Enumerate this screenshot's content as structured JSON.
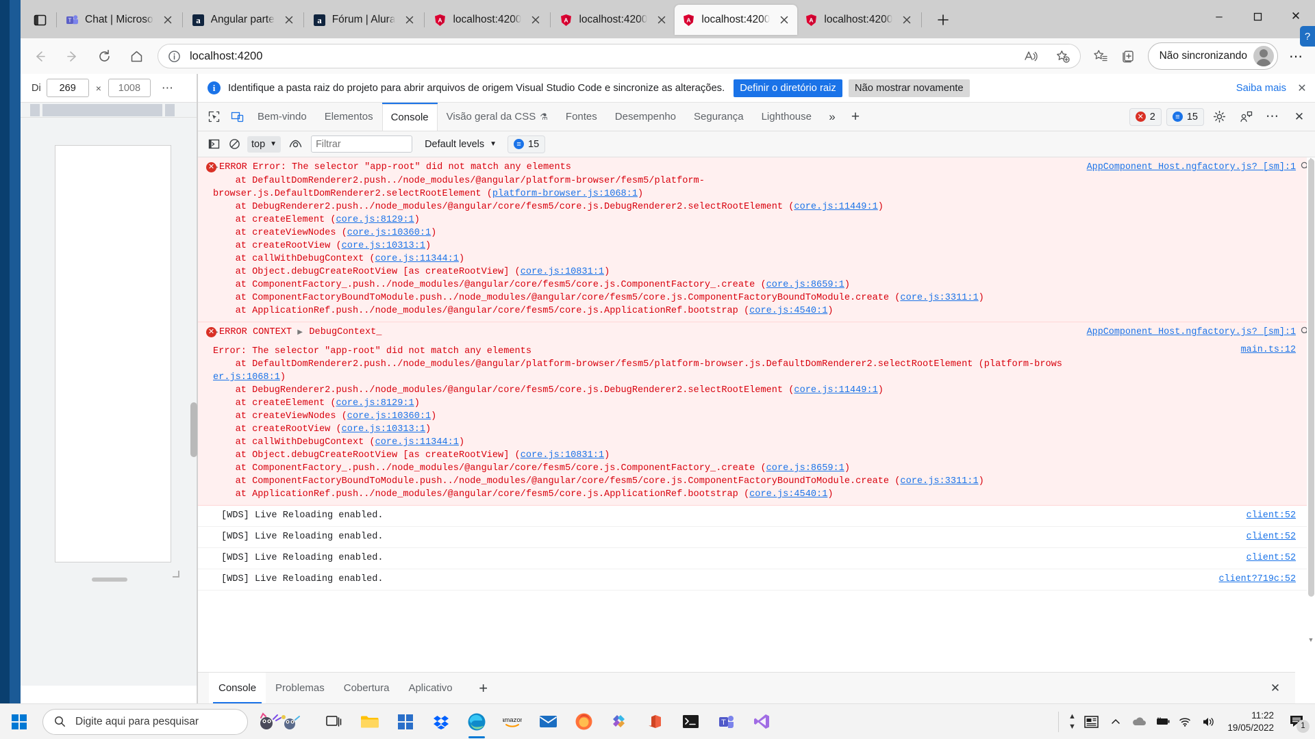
{
  "browser": {
    "tabs": [
      {
        "label": "Chat | Microso",
        "favicon": "teams-icon",
        "active": false
      },
      {
        "label": "Angular parte",
        "favicon": "alura-icon",
        "active": false
      },
      {
        "label": "Fórum | Alura",
        "favicon": "alura-icon",
        "active": false
      },
      {
        "label": "localhost:4200",
        "favicon": "angular-icon",
        "active": false
      },
      {
        "label": "localhost:4200",
        "favicon": "angular-icon",
        "active": false
      },
      {
        "label": "localhost:4200",
        "favicon": "angular-icon",
        "active": true
      },
      {
        "label": "localhost:4200",
        "favicon": "angular-icon",
        "active": false
      }
    ],
    "new_tab_label": "+",
    "window_controls": {
      "minimize": "–",
      "maximize": "▢",
      "close": "✕"
    },
    "address": {
      "url": "localhost:4200",
      "security_icon": "info-circle-icon"
    },
    "profile": {
      "label": "Não sincronizando"
    },
    "help_badge": "?"
  },
  "device_emulation": {
    "label": "Di",
    "width_value": "269",
    "height_value": "1008",
    "height_placeholder": "1008",
    "separator": "×",
    "more": "⋯"
  },
  "devtools": {
    "infobar": {
      "icon": "info-icon",
      "text": "Identifique a pasta raiz do projeto para abrir arquivos de origem Visual Studio Code e sincronize as alterações.",
      "primary_button": "Definir o diretório raiz",
      "secondary_button": "Não mostrar novamente",
      "link": "Saiba mais",
      "close": "✕"
    },
    "tabs": [
      {
        "label": "Bem-vindo",
        "selected": false
      },
      {
        "label": "Elementos",
        "selected": false
      },
      {
        "label": "Console",
        "selected": true
      },
      {
        "label": "Visão geral da CSS",
        "selected": false,
        "beaker": "⚗"
      },
      {
        "label": "Fontes",
        "selected": false
      },
      {
        "label": "Desempenho",
        "selected": false
      },
      {
        "label": "Segurança",
        "selected": false
      },
      {
        "label": "Lighthouse",
        "selected": false
      }
    ],
    "tab_overflow": "»",
    "tab_add": "+",
    "badges": {
      "errors": "2",
      "info": "15"
    },
    "right_icons": [
      "gear-icon",
      "feedback-icon",
      "more-icon",
      "close-icon"
    ],
    "console_toolbar": {
      "clear_icon": "clear-console-icon",
      "sidebar_icon": "console-sidebar-icon",
      "context": "top",
      "eye_icon": "live-expression-icon",
      "filter_placeholder": "Filtrar",
      "filter_value": "",
      "levels": "Default levels",
      "info_badge": "15"
    },
    "drawer_tabs": [
      {
        "label": "Console",
        "selected": true
      },
      {
        "label": "Problemas",
        "selected": false
      },
      {
        "label": "Cobertura",
        "selected": false
      },
      {
        "label": "Aplicativo",
        "selected": false
      }
    ],
    "drawer_add": "+",
    "drawer_close": "✕"
  },
  "console_messages": [
    {
      "kind": "error",
      "header": "ERROR Error: The selector \"app-root\" did not match any elements",
      "lines": [
        "    at DefaultDomRenderer2.push../node_modules/@angular/platform-browser/fesm5/platform-",
        "browser.js.DefaultDomRenderer2.selectRootElement (platform-browser.js:1068:1)",
        "    at DebugRenderer2.push../node_modules/@angular/core/fesm5/core.js.DebugRenderer2.selectRootElement (core.js:11449:1)",
        "    at createElement (core.js:8129:1)",
        "    at createViewNodes (core.js:10360:1)",
        "    at createRootView (core.js:10313:1)",
        "    at callWithDebugContext (core.js:11344:1)",
        "    at Object.debugCreateRootView [as createRootView] (core.js:10831:1)",
        "    at ComponentFactory_.push../node_modules/@angular/core/fesm5/core.js.ComponentFactory_.create (core.js:8659:1)",
        "    at ComponentFactoryBoundToModule.push../node_modules/@angular/core/fesm5/core.js.ComponentFactoryBoundToModule.create (core.js:3311:1)",
        "    at ApplicationRef.push../node_modules/@angular/core/fesm5/core.js.ApplicationRef.bootstrap (core.js:4540:1)"
      ],
      "source": "AppComponent_Host.ngfactory.js? [sm]:1"
    },
    {
      "kind": "error-context",
      "header": "ERROR CONTEXT",
      "context_label": "DebugContext_",
      "source": "AppComponent_Host.ngfactory.js? [sm]:1",
      "body_source": "main.ts:12",
      "lines": [
        "Error: The selector \"app-root\" did not match any elements",
        "    at DefaultDomRenderer2.push../node_modules/@angular/platform-browser/fesm5/platform-browser.js.DefaultDomRenderer2.selectRootElement (platform-brows",
        "er.js:1068:1)",
        "    at DebugRenderer2.push../node_modules/@angular/core/fesm5/core.js.DebugRenderer2.selectRootElement (core.js:11449:1)",
        "    at createElement (core.js:8129:1)",
        "    at createViewNodes (core.js:10360:1)",
        "    at createRootView (core.js:10313:1)",
        "    at callWithDebugContext (core.js:11344:1)",
        "    at Object.debugCreateRootView [as createRootView] (core.js:10831:1)",
        "    at ComponentFactory_.push../node_modules/@angular/core/fesm5/core.js.ComponentFactory_.create (core.js:8659:1)",
        "    at ComponentFactoryBoundToModule.push../node_modules/@angular/core/fesm5/core.js.ComponentFactoryBoundToModule.create (core.js:3311:1)",
        "    at ApplicationRef.push../node_modules/@angular/core/fesm5/core.js.ApplicationRef.bootstrap (core.js:4540:1)"
      ]
    },
    {
      "kind": "log",
      "text": "[WDS] Live Reloading enabled.",
      "source": "client:52"
    },
    {
      "kind": "log",
      "text": "[WDS] Live Reloading enabled.",
      "source": "client:52"
    },
    {
      "kind": "log",
      "text": "[WDS] Live Reloading enabled.",
      "source": "client:52"
    },
    {
      "kind": "log",
      "text": "[WDS] Live Reloading enabled.",
      "source": "client?719c:52"
    }
  ],
  "taskbar": {
    "search_placeholder": "Digite aqui para pesquisar",
    "clock_time": "11:22",
    "clock_date": "19/05/2022",
    "notification_count": "1",
    "apps": [
      "task-view-icon",
      "file-explorer-icon",
      "microsoft-store-icon",
      "dropbox-icon",
      "edge-icon",
      "amazon-icon",
      "mail-icon",
      "firefox-icon",
      "settings-icon",
      "office-icon",
      "terminal-icon",
      "teams-icon",
      "vscode-icon"
    ]
  },
  "colors": {
    "accent_blue": "#1a73e8",
    "error_red": "#d93025",
    "error_bg": "#fff0f0",
    "taskbar_bg": "#f3f3f3",
    "tabstrip_bg": "#cfcfcf"
  }
}
